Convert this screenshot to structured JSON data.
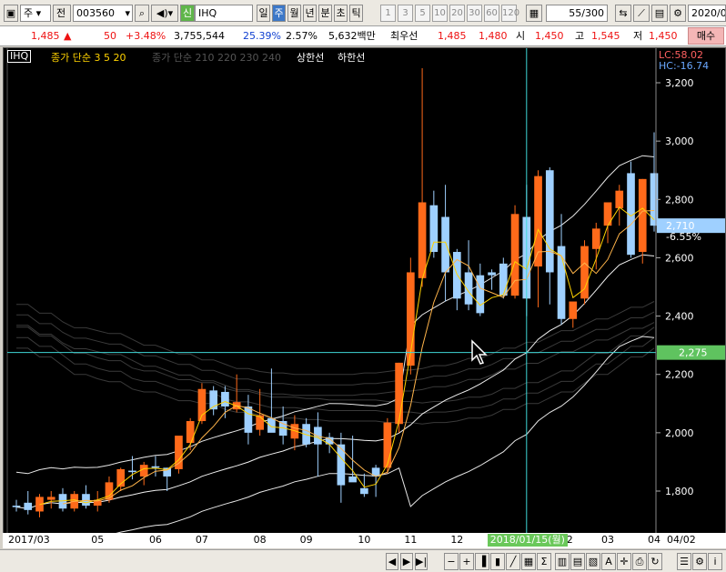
{
  "toolbar": {
    "market_label": "주",
    "all_label": "전",
    "code": "003560",
    "badge": "신",
    "name": "IHQ",
    "periods": [
      "일",
      "주",
      "월",
      "년",
      "분",
      "초",
      "틱"
    ],
    "active_period": "주",
    "numbers": [
      "1",
      "3",
      "5",
      "10",
      "20",
      "30",
      "60",
      "120"
    ],
    "count_value": "55",
    "count_total": "/300",
    "date": "2020/0"
  },
  "pricebar": {
    "price": "1,485",
    "change_arrow": "▲",
    "change": "50",
    "change_pct": "+3.48%",
    "volume": "3,755,544",
    "ratio1": "25.39%",
    "ratio2": "2.57%",
    "amount": "5,632백만",
    "best_bid_label": "최우선",
    "best_ask": "1,485",
    "best_bid": "1,480",
    "open_label": "시",
    "open": "1,450",
    "high_label": "고",
    "high": "1,545",
    "low_label": "저",
    "low": "1,450",
    "buy_button": "매수"
  },
  "legend": {
    "symbol": "IHQ",
    "ma_short": "종가 단순 3  5  20",
    "ma_long": "종가 단순 210  220  230  240",
    "upper": "상한선",
    "lower": "하한선",
    "lc": "LC:58.02",
    "hc": "HC:-16.74"
  },
  "crosshair_price": "2,275",
  "last_price_label": "2,710",
  "last_pct_label": "-6.55%",
  "chart_data": {
    "type": "candlestick",
    "y_ticks": [
      "3,200",
      "3,000",
      "2,800",
      "2,600",
      "2,400",
      "2,200",
      "2,000",
      "1,800"
    ],
    "y_tick_values": [
      3200,
      3000,
      2800,
      2600,
      2400,
      2200,
      2000,
      1800
    ],
    "ylim": [
      1670,
      3230
    ],
    "x_ticks": [
      {
        "label": "2017/03",
        "i": 0
      },
      {
        "label": "05",
        "i": 7
      },
      {
        "label": "06",
        "i": 12
      },
      {
        "label": "07",
        "i": 16
      },
      {
        "label": "08",
        "i": 21
      },
      {
        "label": "09",
        "i": 25
      },
      {
        "label": "10",
        "i": 30
      },
      {
        "label": "11",
        "i": 34
      },
      {
        "label": "12",
        "i": 38
      },
      {
        "label": "2",
        "i": 48
      },
      {
        "label": "03",
        "i": 51
      },
      {
        "label": "04",
        "i": 55
      }
    ],
    "crosshair_date": "2018/01/15(월)",
    "crosshair_index": 44,
    "x_end_label": "04/02",
    "candles": [
      {
        "o": 1750,
        "h": 1770,
        "l": 1730,
        "c": 1745
      },
      {
        "o": 1760,
        "h": 1800,
        "l": 1720,
        "c": 1735
      },
      {
        "o": 1730,
        "h": 1790,
        "l": 1710,
        "c": 1780
      },
      {
        "o": 1770,
        "h": 1800,
        "l": 1740,
        "c": 1780
      },
      {
        "o": 1790,
        "h": 1810,
        "l": 1730,
        "c": 1740
      },
      {
        "o": 1740,
        "h": 1800,
        "l": 1730,
        "c": 1790
      },
      {
        "o": 1790,
        "h": 1820,
        "l": 1740,
        "c": 1750
      },
      {
        "o": 1750,
        "h": 1800,
        "l": 1730,
        "c": 1770
      },
      {
        "o": 1770,
        "h": 1850,
        "l": 1760,
        "c": 1830
      },
      {
        "o": 1815,
        "h": 1880,
        "l": 1800,
        "c": 1875
      },
      {
        "o": 1870,
        "h": 1920,
        "l": 1840,
        "c": 1865
      },
      {
        "o": 1850,
        "h": 1900,
        "l": 1820,
        "c": 1890
      },
      {
        "o": 1885,
        "h": 1920,
        "l": 1850,
        "c": 1880
      },
      {
        "o": 1880,
        "h": 1880,
        "l": 1800,
        "c": 1850
      },
      {
        "o": 1875,
        "h": 1960,
        "l": 1860,
        "c": 1990
      },
      {
        "o": 1965,
        "h": 2050,
        "l": 1940,
        "c": 2040
      },
      {
        "o": 2040,
        "h": 2170,
        "l": 2030,
        "c": 2150
      },
      {
        "o": 2145,
        "h": 2160,
        "l": 2060,
        "c": 2080
      },
      {
        "o": 2140,
        "h": 2160,
        "l": 2050,
        "c": 2090
      },
      {
        "o": 2080,
        "h": 2200,
        "l": 2070,
        "c": 2105
      },
      {
        "o": 2090,
        "h": 2130,
        "l": 1960,
        "c": 2000
      },
      {
        "o": 2010,
        "h": 2150,
        "l": 1990,
        "c": 2060
      },
      {
        "o": 2050,
        "h": 2220,
        "l": 2010,
        "c": 2000
      },
      {
        "o": 2040,
        "h": 2090,
        "l": 1960,
        "c": 1990
      },
      {
        "o": 1980,
        "h": 2060,
        "l": 1940,
        "c": 2030
      },
      {
        "o": 2030,
        "h": 2050,
        "l": 1950,
        "c": 1960
      },
      {
        "o": 2020,
        "h": 2070,
        "l": 1850,
        "c": 1960
      },
      {
        "o": 1985,
        "h": 2000,
        "l": 1930,
        "c": 1960
      },
      {
        "o": 1960,
        "h": 2000,
        "l": 1760,
        "c": 1820
      },
      {
        "o": 1850,
        "h": 1990,
        "l": 1840,
        "c": 1830
      },
      {
        "o": 1810,
        "h": 1860,
        "l": 1780,
        "c": 1790
      },
      {
        "o": 1880,
        "h": 1890,
        "l": 1780,
        "c": 1850
      },
      {
        "o": 1880,
        "h": 2050,
        "l": 1860,
        "c": 2035
      },
      {
        "o": 2030,
        "h": 2240,
        "l": 2000,
        "c": 2240
      },
      {
        "o": 2230,
        "h": 2600,
        "l": 2200,
        "c": 2550
      },
      {
        "o": 2530,
        "h": 3250,
        "l": 2500,
        "c": 2790
      },
      {
        "o": 2780,
        "h": 2830,
        "l": 2600,
        "c": 2620
      },
      {
        "o": 2740,
        "h": 2850,
        "l": 2450,
        "c": 2550
      },
      {
        "o": 2620,
        "h": 2630,
        "l": 2420,
        "c": 2460
      },
      {
        "o": 2550,
        "h": 2660,
        "l": 2420,
        "c": 2440
      },
      {
        "o": 2540,
        "h": 2580,
        "l": 2400,
        "c": 2410
      },
      {
        "o": 2550,
        "h": 2560,
        "l": 2490,
        "c": 2540
      },
      {
        "o": 2580,
        "h": 2600,
        "l": 2460,
        "c": 2470
      },
      {
        "o": 2470,
        "h": 2780,
        "l": 2460,
        "c": 2750
      },
      {
        "o": 2740,
        "h": 2850,
        "l": 2400,
        "c": 2460
      },
      {
        "o": 2570,
        "h": 2900,
        "l": 2430,
        "c": 2880
      },
      {
        "o": 2900,
        "h": 2910,
        "l": 2440,
        "c": 2550
      },
      {
        "o": 2640,
        "h": 2750,
        "l": 2370,
        "c": 2390
      },
      {
        "o": 2390,
        "h": 2420,
        "l": 2360,
        "c": 2450
      },
      {
        "o": 2460,
        "h": 2660,
        "l": 2440,
        "c": 2640
      },
      {
        "o": 2630,
        "h": 2720,
        "l": 2560,
        "c": 2700
      },
      {
        "o": 2710,
        "h": 2790,
        "l": 2650,
        "c": 2790
      },
      {
        "o": 2770,
        "h": 2850,
        "l": 2710,
        "c": 2830
      },
      {
        "o": 2890,
        "h": 2930,
        "l": 2600,
        "c": 2610
      },
      {
        "o": 2620,
        "h": 2870,
        "l": 2580,
        "c": 2870
      },
      {
        "o": 2890,
        "h": 3030,
        "l": 2690,
        "c": 2710
      }
    ]
  }
}
